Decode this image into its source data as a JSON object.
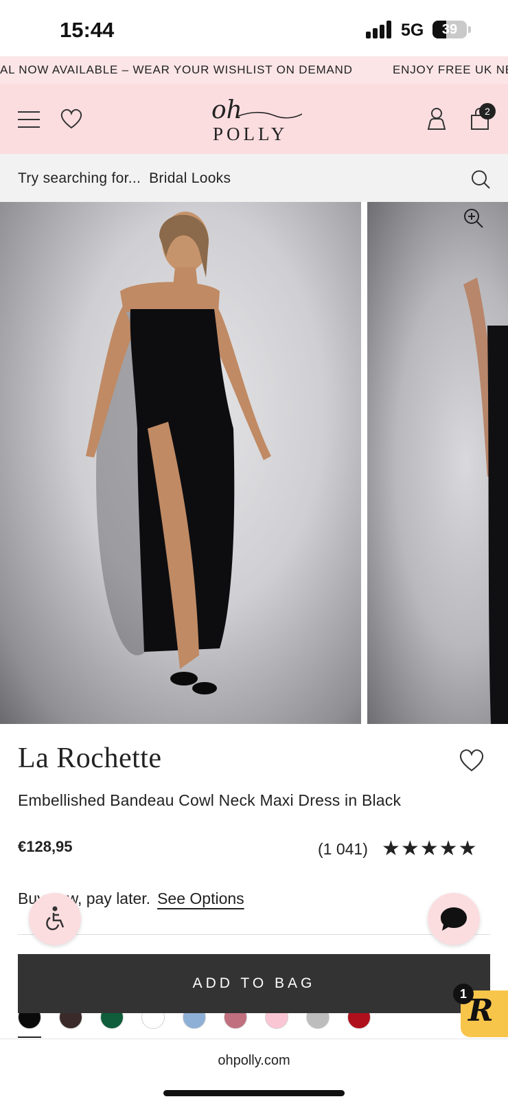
{
  "status_bar": {
    "time": "15:44",
    "network": "5G",
    "battery": "39",
    "battery_level": 0.39
  },
  "announcement": {
    "left_text": "AL NOW AVAILABLE – WEAR YOUR WISHLIST ON DEMAND",
    "right_text": "ENJOY FREE UK NE"
  },
  "header": {
    "logo_top": "oh",
    "logo_bottom": "POLLY",
    "cart_count": "2"
  },
  "search": {
    "prefix": "Try searching for...",
    "suggestion": "Bridal Looks"
  },
  "product": {
    "brand": "La Rochette",
    "name": "Embellished Bandeau Cowl Neck Maxi Dress in Black",
    "price": "€128,95",
    "review_count": "(1 041)",
    "rating_stars": "★★★★★",
    "rating": 5,
    "bnpl_text": "Buy now, pay later.",
    "bnpl_link": "See Options"
  },
  "actions": {
    "add_to_bag": "ADD TO BAG"
  },
  "swatches": [
    {
      "name": "black",
      "color": "#0a0a0a"
    },
    {
      "name": "dark-brown",
      "color": "#3a2a2a"
    },
    {
      "name": "green",
      "color": "#0f5d3a"
    },
    {
      "name": "white",
      "color": "#ffffff"
    },
    {
      "name": "blue",
      "color": "#8fb0d6"
    },
    {
      "name": "pink-floral",
      "color": "#c0707e"
    },
    {
      "name": "light-pink",
      "color": "#fbc6d4"
    },
    {
      "name": "grey",
      "color": "#bdbdbd"
    },
    {
      "name": "red",
      "color": "#b0101c"
    }
  ],
  "rewards": {
    "letter": "R",
    "badge": "1"
  },
  "browser": {
    "url": "ohpolly.com"
  },
  "colors": {
    "header_pink": "#fbdde0",
    "button_dark": "#333333",
    "rewards_yellow": "#f8c54b"
  },
  "icons": [
    "menu-icon",
    "heart-icon",
    "account-icon",
    "bag-icon",
    "search-icon",
    "zoom-in-icon",
    "accessibility-icon",
    "chat-icon",
    "star-icon"
  ]
}
